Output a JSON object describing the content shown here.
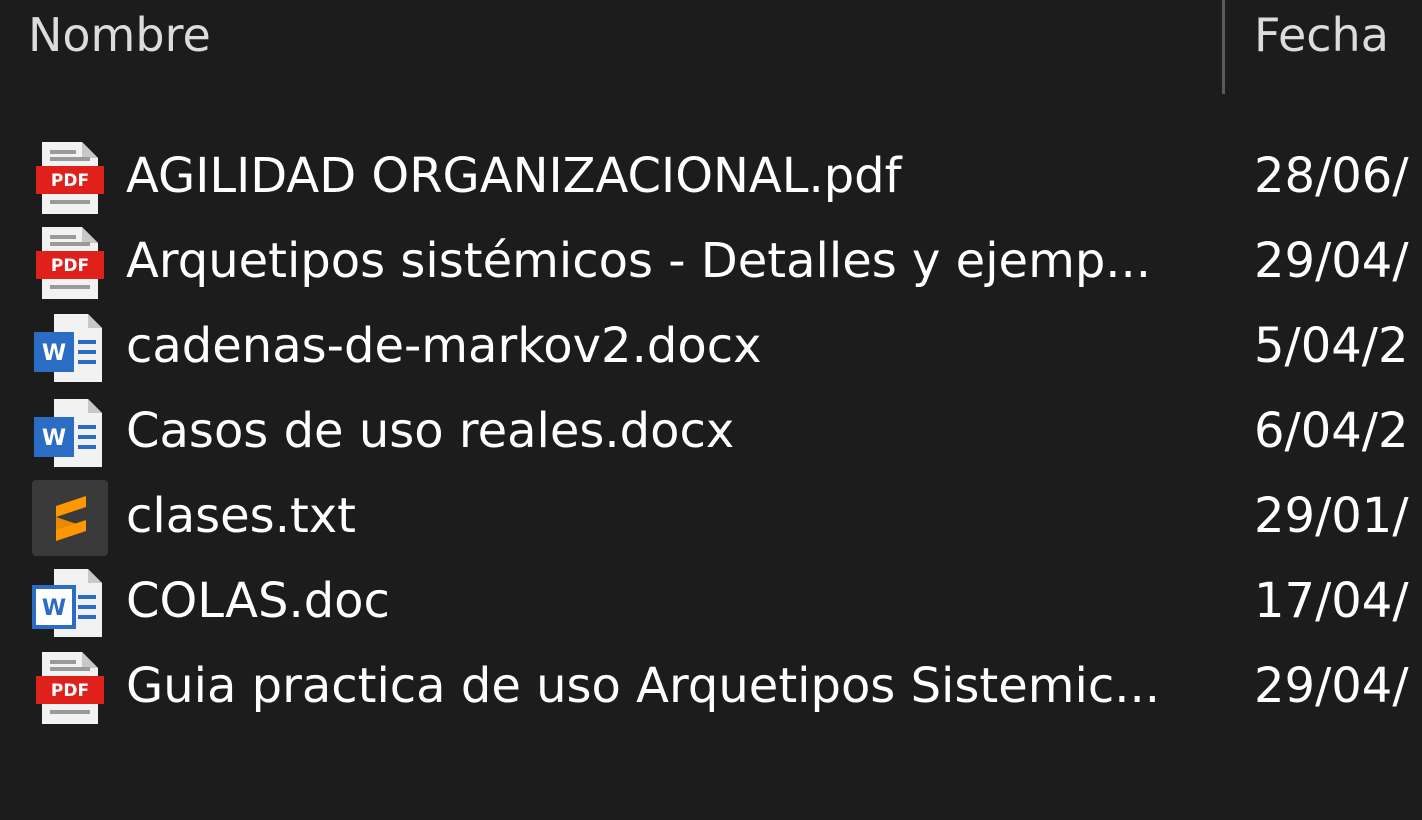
{
  "columns": {
    "name": "Nombre",
    "date": "Fecha"
  },
  "files": [
    {
      "name": "AGILIDAD ORGANIZACIONAL.pdf",
      "date": "28/06/",
      "icon": "pdf-icon"
    },
    {
      "name": "Arquetipos sistémicos - Detalles y ejemp...",
      "date": "29/04/",
      "icon": "pdf-icon"
    },
    {
      "name": "cadenas-de-markov2.docx",
      "date": "5/04/2",
      "icon": "word-docx-icon"
    },
    {
      "name": "Casos de uso reales.docx",
      "date": "6/04/2",
      "icon": "word-docx-icon"
    },
    {
      "name": "clases.txt",
      "date": "29/01/",
      "icon": "sublime-text-icon"
    },
    {
      "name": "COLAS.doc",
      "date": "17/04/",
      "icon": "word-doc-icon"
    },
    {
      "name": "Guia practica de uso Arquetipos Sistemic...",
      "date": "29/04/",
      "icon": "pdf-icon"
    }
  ],
  "colors": {
    "background": "#1c1c1c",
    "text": "#ffffff",
    "pdf_red": "#e0201b",
    "word_blue": "#2b6cc4",
    "sublime_orange": "#ff9800"
  }
}
